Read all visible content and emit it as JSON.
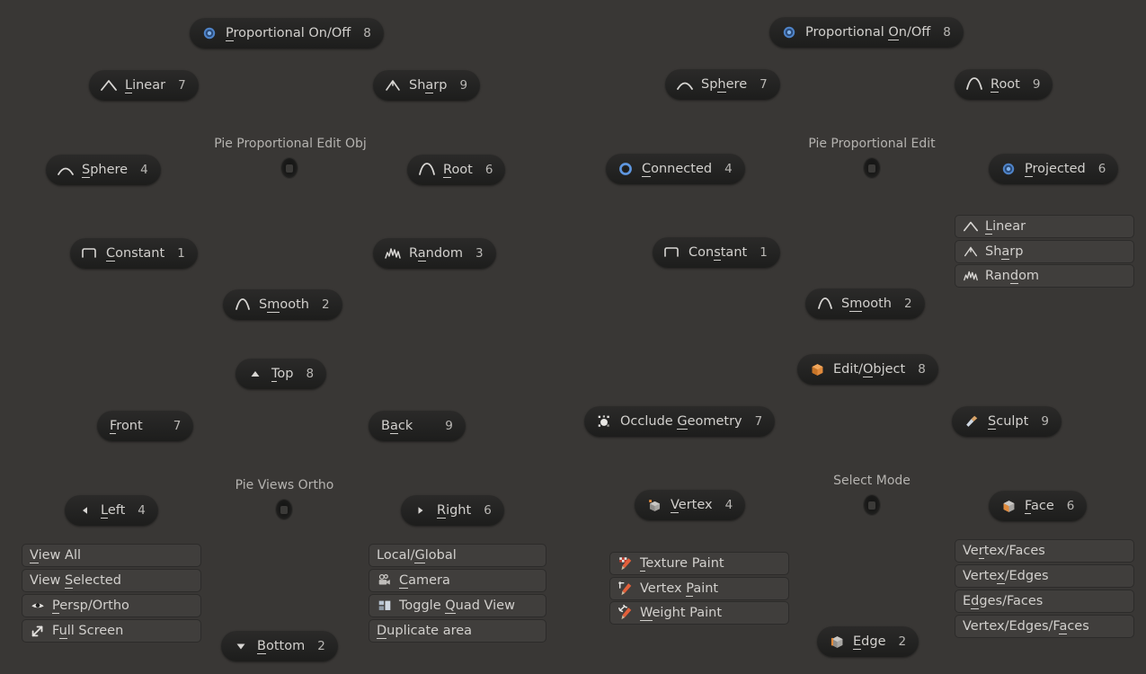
{
  "theme": {
    "background": "#393735",
    "pill_top": "#2b2a29",
    "pill_bottom": "#1d1d1c",
    "item_fill": "#403e3c",
    "item_border": "#2c2b2a",
    "text": "#d2d0cd",
    "title_text": "#b5b3b0",
    "accent_blue": "#4772b3",
    "accent_orange": "#e08a3c"
  },
  "pies": [
    {
      "id": "pie-proportional-edit-obj",
      "title": "Pie Proportional Edit Obj",
      "buttons": [
        {
          "icon": "radio-on-icon",
          "pre": "",
          "acc": "P",
          "post": "roportional On/Off",
          "key": "8"
        },
        {
          "icon": "falloff-linear-icon",
          "pre": "",
          "acc": "L",
          "post": "inear",
          "key": "7"
        },
        {
          "icon": "falloff-sharp-icon",
          "pre": "Sh",
          "acc": "a",
          "post": "rp",
          "key": "9"
        },
        {
          "icon": "falloff-sphere-icon",
          "pre": "",
          "acc": "S",
          "post": "phere",
          "key": "4"
        },
        {
          "icon": "falloff-root-icon",
          "pre": "",
          "acc": "R",
          "post": "oot",
          "key": "6"
        },
        {
          "icon": "falloff-constant-icon",
          "pre": "",
          "acc": "C",
          "post": "onstant",
          "key": "1"
        },
        {
          "icon": "falloff-random-icon",
          "pre": "R",
          "acc": "a",
          "post": "ndom",
          "key": "3"
        },
        {
          "icon": "falloff-smooth-icon",
          "pre": "S",
          "acc": "m",
          "post": "ooth",
          "key": "2"
        }
      ]
    },
    {
      "id": "pie-proportional-edit",
      "title": "Pie Proportional Edit",
      "buttons": [
        {
          "icon": "radio-on-icon",
          "pre": "Proportional ",
          "acc": "O",
          "post": "n/Off",
          "key": "8"
        },
        {
          "icon": "falloff-sphere-icon",
          "pre": "Sp",
          "acc": "h",
          "post": "ere",
          "key": "7"
        },
        {
          "icon": "falloff-root-icon",
          "pre": "",
          "acc": "R",
          "post": "oot",
          "key": "9"
        },
        {
          "icon": "radio-ring-icon",
          "pre": "",
          "acc": "C",
          "post": "onnected",
          "key": "4"
        },
        {
          "icon": "radio-on-icon",
          "pre": "",
          "acc": "P",
          "post": "rojected",
          "key": "6"
        },
        {
          "icon": "falloff-constant-icon",
          "pre": "Con",
          "acc": "s",
          "post": "tant",
          "key": "1"
        },
        {
          "icon": "falloff-smooth-icon",
          "pre": "S",
          "acc": "m",
          "post": "ooth",
          "key": "2"
        }
      ],
      "list": [
        {
          "icon": "falloff-linear-icon",
          "pre": "",
          "acc": "L",
          "post": "inear"
        },
        {
          "icon": "falloff-sharp-icon",
          "pre": "Sh",
          "acc": "a",
          "post": "rp"
        },
        {
          "icon": "falloff-random-icon",
          "pre": "Ran",
          "acc": "d",
          "post": "om"
        }
      ]
    },
    {
      "id": "pie-views-ortho",
      "title": "Pie Views Ortho",
      "buttons": [
        {
          "icon": "triangle-up-icon",
          "pre": "",
          "acc": "T",
          "post": "op",
          "key": "8"
        },
        {
          "icon": "none",
          "pre": "",
          "acc": "F",
          "post": "ront",
          "key": "7"
        },
        {
          "icon": "none",
          "pre": "B",
          "acc": "a",
          "post": "ck",
          "key": "9"
        },
        {
          "icon": "triangle-left-icon",
          "pre": "",
          "acc": "L",
          "post": "eft",
          "key": "4"
        },
        {
          "icon": "triangle-right-icon",
          "pre": "",
          "acc": "R",
          "post": "ight",
          "key": "6"
        },
        {
          "icon": "triangle-down-icon",
          "pre": "",
          "acc": "B",
          "post": "ottom",
          "key": "2"
        }
      ],
      "list_left": [
        {
          "icon": "none",
          "pre": "",
          "acc": "V",
          "post": "iew All"
        },
        {
          "icon": "none",
          "pre": "View ",
          "acc": "S",
          "post": "elected"
        },
        {
          "icon": "eye-icon",
          "pre": "",
          "acc": "P",
          "post": "ersp/Ortho"
        },
        {
          "icon": "fullscreen-icon",
          "pre": "F",
          "acc": "u",
          "post": "ll Screen"
        }
      ],
      "list_right": [
        {
          "icon": "none",
          "pre": "Local/",
          "acc": "G",
          "post": "lobal"
        },
        {
          "icon": "camera-icon",
          "pre": "",
          "acc": "C",
          "post": "amera"
        },
        {
          "icon": "quadview-icon",
          "pre": "Toggle ",
          "acc": "Q",
          "post": "uad View"
        },
        {
          "icon": "none",
          "pre": "",
          "acc": "D",
          "post": "uplicate area"
        }
      ]
    },
    {
      "id": "pie-select-mode",
      "title": "Select Mode",
      "buttons": [
        {
          "icon": "cube-object-icon",
          "pre": "Edit/",
          "acc": "O",
          "post": "bject",
          "key": "8"
        },
        {
          "icon": "occlude-icon",
          "pre": "Occlude ",
          "acc": "G",
          "post": "eometry",
          "key": "7"
        },
        {
          "icon": "sculpt-brush-icon",
          "pre": "",
          "acc": "S",
          "post": "culpt",
          "key": "9"
        },
        {
          "icon": "vertex-cube-icon",
          "pre": "",
          "acc": "V",
          "post": "ertex",
          "key": "4"
        },
        {
          "icon": "face-cube-icon",
          "pre": "",
          "acc": "F",
          "post": "ace",
          "key": "6"
        },
        {
          "icon": "edge-cube-icon",
          "pre": "",
          "acc": "E",
          "post": "dge",
          "key": "2"
        }
      ],
      "list_left": [
        {
          "icon": "texture-paint-icon",
          "pre": "",
          "acc": "T",
          "post": "exture Paint"
        },
        {
          "icon": "vertex-paint-icon",
          "pre": "Vertex ",
          "acc": "P",
          "post": "aint"
        },
        {
          "icon": "weight-paint-icon",
          "pre": "",
          "acc": "W",
          "post": "eight Paint"
        }
      ],
      "list_right": [
        {
          "icon": "none",
          "pre": "Ve",
          "acc": "r",
          "post": "tex/Faces"
        },
        {
          "icon": "none",
          "pre": "Verte",
          "acc": "x",
          "post": "/Edges"
        },
        {
          "icon": "none",
          "pre": "E",
          "acc": "d",
          "post": "ges/Faces"
        },
        {
          "icon": "none",
          "pre": "Vertex/Edges/F",
          "acc": "a",
          "post": "ces"
        }
      ]
    }
  ]
}
